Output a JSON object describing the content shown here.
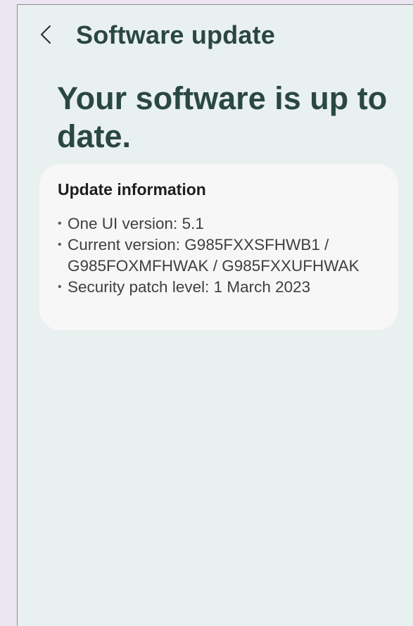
{
  "header": {
    "back_icon": "chevron-left-icon",
    "title": "Software update"
  },
  "status": {
    "headline": "Your software is up to date."
  },
  "update_info": {
    "title": "Update information",
    "items": [
      "One UI version: 5.1",
      "Current version: G985FXXSFHWB1 / G985FOXMFHWAK / G985FXXUFHWAK",
      "Security patch level: 1 March 2023"
    ]
  },
  "colors": {
    "background": "#e9f1f0",
    "card": "#f7f7f7",
    "accent_text": "#2a4744"
  }
}
